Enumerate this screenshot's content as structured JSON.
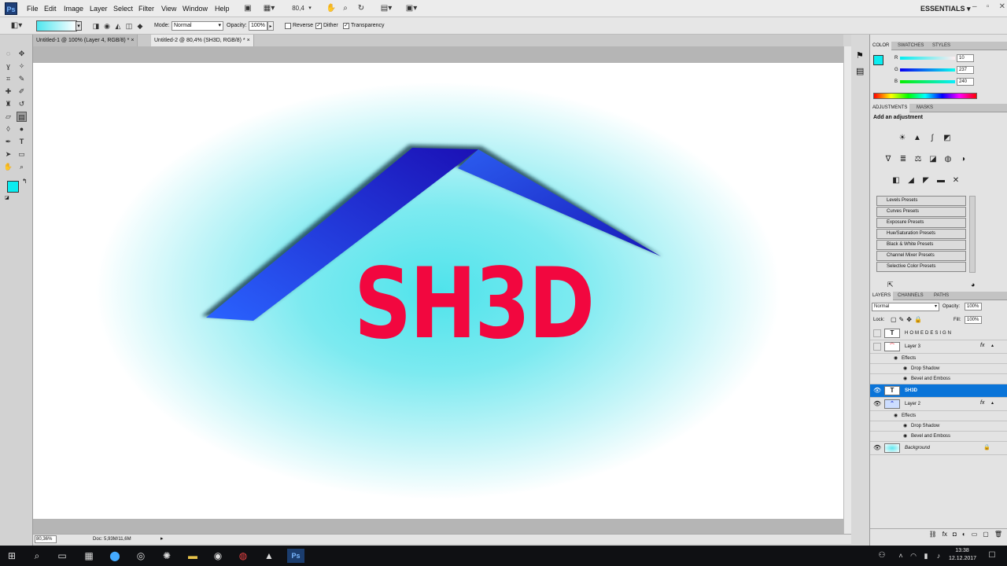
{
  "app": {
    "logo": "Ps",
    "workspace_label": "ESSENTIALS",
    "zoom_display": "80,4"
  },
  "menu": {
    "items": [
      "File",
      "Edit",
      "Image",
      "Layer",
      "Select",
      "Filter",
      "View",
      "Window",
      "Help"
    ]
  },
  "options": {
    "mode_label": "Mode:",
    "mode_value": "Normal",
    "opacity_label": "Opacity:",
    "opacity_value": "100%",
    "reverse_label": "Reverse",
    "dither_label": "Dither",
    "transparency_label": "Transparency",
    "reverse_checked": false,
    "dither_checked": true,
    "transparency_checked": true
  },
  "tabs": [
    {
      "label": "Untitled-1 @ 100% (Layer 4, RGB/8) *",
      "close": "×",
      "active": false
    },
    {
      "label": "Untitled-2 @ 80,4% (SH3D, RGB/8) *",
      "close": "×",
      "active": true
    }
  ],
  "canvas": {
    "logo_text": "SH3D",
    "text_color": "#f2073f",
    "roof_color": "#1f4fe0",
    "bg_center": "#4fe3eb"
  },
  "status": {
    "zoom": "80,36%",
    "doc": "Doc: 5,93M/11,6M"
  },
  "color_panel": {
    "tabs": [
      "COLOR",
      "SWATCHES",
      "STYLES"
    ],
    "r_label": "R",
    "g_label": "G",
    "b_label": "B",
    "r_value": "10",
    "g_value": "237",
    "b_value": "240",
    "fg_color": "#0aedf0"
  },
  "adjustments": {
    "tabs": [
      "ADJUSTMENTS",
      "MASKS"
    ],
    "title": "Add an adjustment",
    "presets": [
      "Levels Presets",
      "Curves Presets",
      "Exposure Presets",
      "Hue/Saturation Presets",
      "Black & White Presets",
      "Channel Mixer Presets",
      "Selective Color Presets"
    ]
  },
  "layers_panel": {
    "tabs": [
      "LAYERS",
      "CHANNELS",
      "PATHS"
    ],
    "blend_mode": "Normal",
    "opacity_label": "Opacity:",
    "opacity_value": "100%",
    "lock_label": "Lock:",
    "fill_label": "Fill:",
    "fill_value": "100%",
    "layers": [
      {
        "name": "HOMEDESIGN",
        "kind": "text"
      },
      {
        "name": "Layer 3",
        "kind": "image"
      },
      {
        "name": "Effects",
        "kind": "effect-group"
      },
      {
        "name": "Drop Shadow",
        "kind": "effect"
      },
      {
        "name": "Bevel and Emboss",
        "kind": "effect"
      },
      {
        "name": "SH3D",
        "kind": "text",
        "selected": true
      },
      {
        "name": "Layer 2",
        "kind": "image"
      },
      {
        "name": "Effects",
        "kind": "effect-group"
      },
      {
        "name": "Drop Shadow",
        "kind": "effect"
      },
      {
        "name": "Bevel and Emboss",
        "kind": "effect"
      },
      {
        "name": "Background",
        "kind": "background"
      }
    ]
  },
  "taskbar": {
    "time": "13:38",
    "date": "12.12.2017"
  }
}
